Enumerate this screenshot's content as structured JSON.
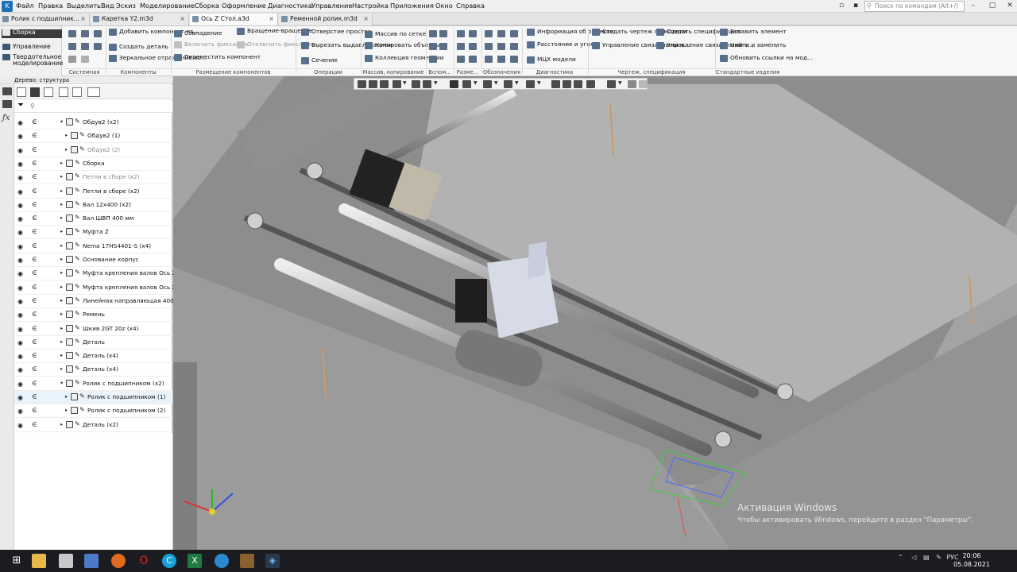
{
  "app": {
    "menu": [
      "Файл",
      "Правка",
      "Выделить",
      "Вид",
      "Эскиз",
      "Моделирование",
      "Сборка",
      "Оформление",
      "Диагностика",
      "Управление",
      "Настройка",
      "Приложения",
      "Окно",
      "Справка"
    ],
    "search_placeholder": "Поиск по командам (Alt+/)",
    "accent": "#1e6fb8"
  },
  "tabs": [
    {
      "label": "Ролик с подшипник..."
    },
    {
      "label": "Каретка Y2.m3d"
    },
    {
      "label": "Ось Z Стол.a3d",
      "active": true
    },
    {
      "label": "Ременной ролик.m3d"
    }
  ],
  "ribbon": {
    "side": [
      "Сборка",
      "Управление",
      "Твердотельное моделирование"
    ],
    "groups": {
      "system": "Системная",
      "components": "Компоненты",
      "placement": "Размещение компонентов",
      "operations": "Операции",
      "arrays": "Массив, копирование",
      "aux": "Вспом...",
      "dims": "Разме...",
      "marks": "Обозначения",
      "diag": "Диагностика",
      "drawing": "Чертеж, спецификация",
      "std": "Стандартные изделия"
    },
    "buttons": {
      "add_component": "Добавить компонент из...",
      "create_part": "Создать деталь",
      "mirror_component": "Зеркальное отражение ко...",
      "coincidence": "Совпадение",
      "enable_fix": "Включить фиксацию",
      "move_component": "Переместить компонент",
      "rotate": "Вращение-вращение",
      "disable_fix": "Отключить фиксацию",
      "simple_hole": "Отверстие простое",
      "extrude_cut": "Вырезать выдавливанием",
      "section": "Сечение",
      "grid_array": "Массив по сетке",
      "copy_objects": "Копировать объекты",
      "geometry_collection": "Коллекция геометрии",
      "object_info": "Информация об объекте",
      "distance_angle": "Расстояние и угол",
      "mcx": "МЦХ модели",
      "create_drawing": "Создать чертеж по модели",
      "manage_linked": "Управление связанными ч...",
      "create_spec": "Создать спецификацию",
      "manage_linked_spec": "Управление связанными с...",
      "insert_element": "Вставить элемент",
      "find_replace": "Найти и заменить",
      "update_links": "Обновить ссылки на мод..."
    }
  },
  "tree": {
    "title": "Дерево: структура",
    "filter_placeholder": "",
    "rows": [
      {
        "label": "Обдув2 (x2)",
        "indent": 1,
        "expanded": true
      },
      {
        "label": "Обдув2 (1)",
        "indent": 2
      },
      {
        "label": "Обдув2 (2)",
        "indent": 2,
        "dim": true
      },
      {
        "label": "Сборка",
        "indent": 1
      },
      {
        "label": "Петли в сборе (x2)",
        "indent": 1,
        "dim": true
      },
      {
        "label": "Петли в сборе (x2)",
        "indent": 1
      },
      {
        "label": "Вал 12x400 (x2)",
        "indent": 1
      },
      {
        "label": "Вал ШВП 400 мм",
        "indent": 1
      },
      {
        "label": "Муфта Z",
        "indent": 1
      },
      {
        "label": "Nema 17HS4401-S (x4)",
        "indent": 1
      },
      {
        "label": "Основание корпус",
        "indent": 1
      },
      {
        "label": "Муфта крепления валов Ось Z",
        "indent": 1
      },
      {
        "label": "Муфта крепления валов Ось Z",
        "indent": 1
      },
      {
        "label": "Линейная направляющая 400мм",
        "indent": 1
      },
      {
        "label": "Ремень",
        "indent": 1
      },
      {
        "label": "Шкив 2GT 20z (x4)",
        "indent": 1
      },
      {
        "label": "Деталь",
        "indent": 1
      },
      {
        "label": "Деталь (x4)",
        "indent": 1
      },
      {
        "label": "Деталь (x4)",
        "indent": 1
      },
      {
        "label": "Ролик с подшипником (x2)",
        "indent": 1,
        "expanded": true
      },
      {
        "label": "Ролик с подшипником (1)",
        "indent": 2,
        "selected": true
      },
      {
        "label": "Ролик с подшипником (2)",
        "indent": 2
      },
      {
        "label": "Деталь (x2)",
        "indent": 1
      }
    ]
  },
  "viewport": {
    "watermark_title": "Активация Windows",
    "watermark_text": "Чтобы активировать Windows, перейдите в раздел \"Параметры\"."
  },
  "taskbar": {
    "lang": "РУС",
    "time": "20:06",
    "date": "05.08.2021"
  }
}
